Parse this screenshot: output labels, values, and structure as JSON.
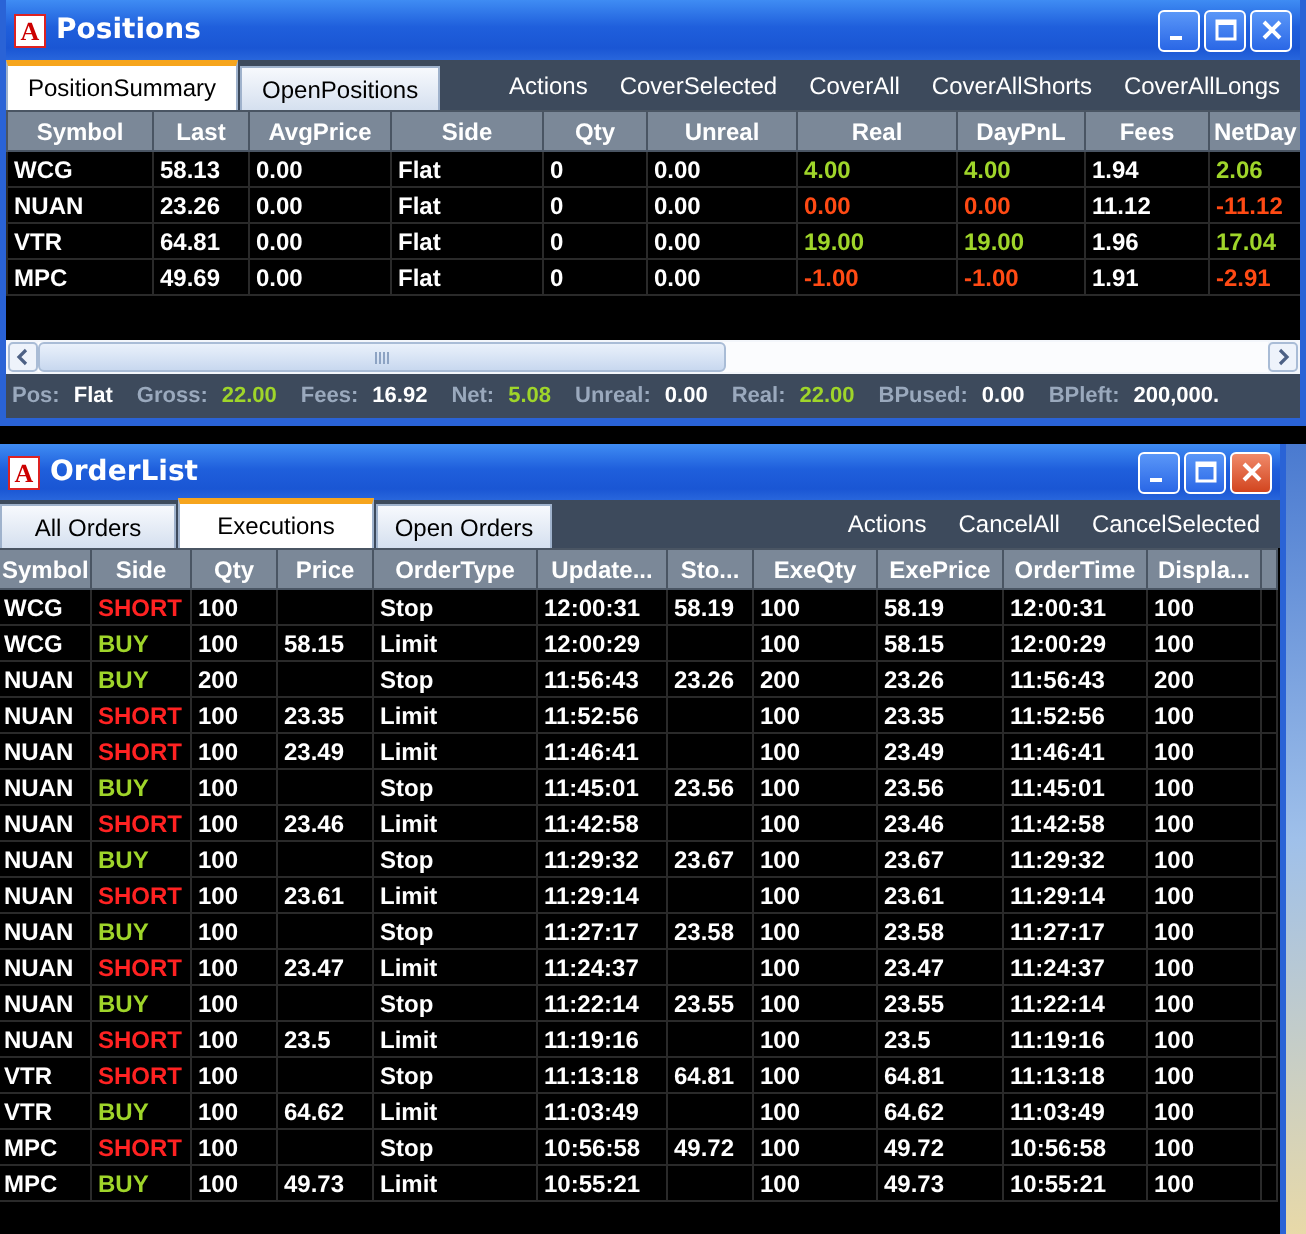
{
  "positions_window": {
    "logo": "A",
    "title": "Positions",
    "tabs": [
      {
        "label": "PositionSummary",
        "selected": true
      },
      {
        "label": "OpenPositions",
        "selected": false
      }
    ],
    "actions": [
      "Actions",
      "CoverSelected",
      "CoverAll",
      "CoverAllShorts",
      "CoverAllLongs"
    ],
    "columns": [
      "Symbol",
      "Last",
      "AvgPrice",
      "Side",
      "Qty",
      "Unreal",
      "Real",
      "DayPnL",
      "Fees",
      "NetDay"
    ],
    "rows": [
      {
        "positive": true,
        "cells": [
          "WCG",
          "58.13",
          "0.00",
          "Flat",
          "0",
          "0.00",
          "4.00",
          "4.00",
          "1.94",
          "2.06"
        ]
      },
      {
        "positive": false,
        "cells": [
          "NUAN",
          "23.26",
          "0.00",
          "Flat",
          "0",
          "0.00",
          "0.00",
          "0.00",
          "11.12",
          "-11.12"
        ]
      },
      {
        "positive": true,
        "cells": [
          "VTR",
          "64.81",
          "0.00",
          "Flat",
          "0",
          "0.00",
          "19.00",
          "19.00",
          "1.96",
          "17.04"
        ]
      },
      {
        "positive": false,
        "cells": [
          "MPC",
          "49.69",
          "0.00",
          "Flat",
          "0",
          "0.00",
          "-1.00",
          "-1.00",
          "1.91",
          "-2.91"
        ]
      }
    ],
    "status": [
      {
        "label": "Pos:",
        "value": "Flat",
        "positive": false
      },
      {
        "label": "Gross:",
        "value": "22.00",
        "positive": true
      },
      {
        "label": "Fees:",
        "value": "16.92",
        "positive": false
      },
      {
        "label": "Net:",
        "value": "5.08",
        "positive": true
      },
      {
        "label": "Unreal:",
        "value": "0.00",
        "positive": false
      },
      {
        "label": "Real:",
        "value": "22.00",
        "positive": true
      },
      {
        "label": "BPused:",
        "value": "0.00",
        "positive": false
      },
      {
        "label": "BPleft:",
        "value": "200,000.",
        "positive": false
      }
    ]
  },
  "orderlist_window": {
    "logo": "A",
    "title": "OrderList",
    "tabs": [
      {
        "label": "All Orders",
        "selected": false
      },
      {
        "label": "Executions",
        "selected": true
      },
      {
        "label": "Open Orders",
        "selected": false
      }
    ],
    "actions": [
      "Actions",
      "CancelAll",
      "CancelSelected"
    ],
    "columns": [
      "Symbol",
      "Side",
      "Qty",
      "Price",
      "OrderType",
      "Update...",
      "Sto...",
      "ExeQty",
      "ExePrice",
      "OrderTime",
      "Displa..."
    ],
    "rows": [
      {
        "kind": "short",
        "cells": [
          "WCG",
          "SHORT",
          "100",
          "",
          "Stop",
          "12:00:31",
          "58.19",
          "100",
          "58.19",
          "12:00:31",
          "100"
        ]
      },
      {
        "kind": "buy",
        "cells": [
          "WCG",
          "BUY",
          "100",
          "58.15",
          "Limit",
          "12:00:29",
          "",
          "100",
          "58.15",
          "12:00:29",
          "100"
        ]
      },
      {
        "kind": "buy",
        "cells": [
          "NUAN",
          "BUY",
          "200",
          "",
          "Stop",
          "11:56:43",
          "23.26",
          "200",
          "23.26",
          "11:56:43",
          "200"
        ]
      },
      {
        "kind": "short",
        "cells": [
          "NUAN",
          "SHORT",
          "100",
          "23.35",
          "Limit",
          "11:52:56",
          "",
          "100",
          "23.35",
          "11:52:56",
          "100"
        ]
      },
      {
        "kind": "short",
        "cells": [
          "NUAN",
          "SHORT",
          "100",
          "23.49",
          "Limit",
          "11:46:41",
          "",
          "100",
          "23.49",
          "11:46:41",
          "100"
        ]
      },
      {
        "kind": "buy",
        "cells": [
          "NUAN",
          "BUY",
          "100",
          "",
          "Stop",
          "11:45:01",
          "23.56",
          "100",
          "23.56",
          "11:45:01",
          "100"
        ]
      },
      {
        "kind": "short",
        "cells": [
          "NUAN",
          "SHORT",
          "100",
          "23.46",
          "Limit",
          "11:42:58",
          "",
          "100",
          "23.46",
          "11:42:58",
          "100"
        ]
      },
      {
        "kind": "buy",
        "cells": [
          "NUAN",
          "BUY",
          "100",
          "",
          "Stop",
          "11:29:32",
          "23.67",
          "100",
          "23.67",
          "11:29:32",
          "100"
        ]
      },
      {
        "kind": "short",
        "cells": [
          "NUAN",
          "SHORT",
          "100",
          "23.61",
          "Limit",
          "11:29:14",
          "",
          "100",
          "23.61",
          "11:29:14",
          "100"
        ]
      },
      {
        "kind": "buy",
        "cells": [
          "NUAN",
          "BUY",
          "100",
          "",
          "Stop",
          "11:27:17",
          "23.58",
          "100",
          "23.58",
          "11:27:17",
          "100"
        ]
      },
      {
        "kind": "short",
        "cells": [
          "NUAN",
          "SHORT",
          "100",
          "23.47",
          "Limit",
          "11:24:37",
          "",
          "100",
          "23.47",
          "11:24:37",
          "100"
        ]
      },
      {
        "kind": "buy",
        "cells": [
          "NUAN",
          "BUY",
          "100",
          "",
          "Stop",
          "11:22:14",
          "23.55",
          "100",
          "23.55",
          "11:22:14",
          "100"
        ]
      },
      {
        "kind": "short",
        "cells": [
          "NUAN",
          "SHORT",
          "100",
          "23.5",
          "Limit",
          "11:19:16",
          "",
          "100",
          "23.5",
          "11:19:16",
          "100"
        ]
      },
      {
        "kind": "short",
        "cells": [
          "VTR",
          "SHORT",
          "100",
          "",
          "Stop",
          "11:13:18",
          "64.81",
          "100",
          "64.81",
          "11:13:18",
          "100"
        ]
      },
      {
        "kind": "buy",
        "cells": [
          "VTR",
          "BUY",
          "100",
          "64.62",
          "Limit",
          "11:03:49",
          "",
          "100",
          "64.62",
          "11:03:49",
          "100"
        ]
      },
      {
        "kind": "short",
        "cells": [
          "MPC",
          "SHORT",
          "100",
          "",
          "Stop",
          "10:56:58",
          "49.72",
          "100",
          "49.72",
          "10:56:58",
          "100"
        ]
      },
      {
        "kind": "buy",
        "cells": [
          "MPC",
          "BUY",
          "100",
          "49.73",
          "Limit",
          "10:55:21",
          "",
          "100",
          "49.73",
          "10:55:21",
          "100"
        ]
      }
    ]
  }
}
